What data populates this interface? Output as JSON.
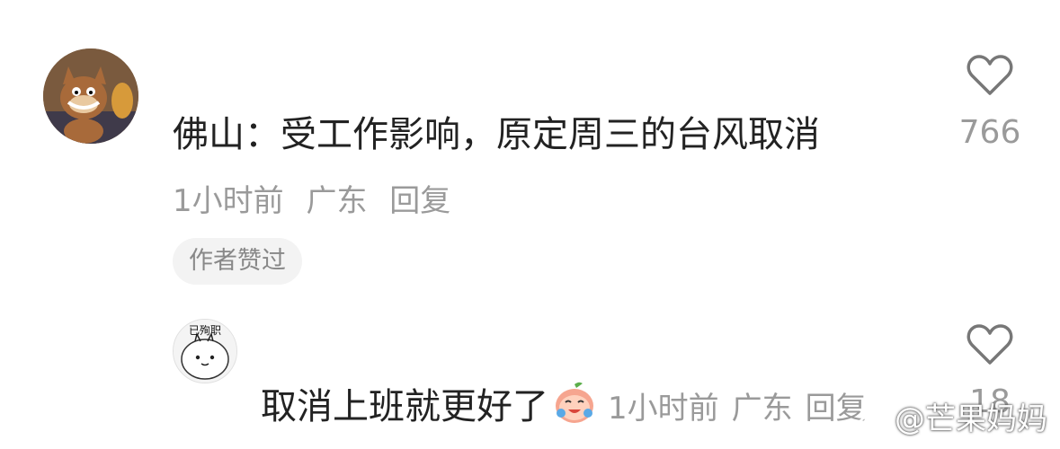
{
  "comments": [
    {
      "text": "佛山：受工作影响，原定周三的台风取消",
      "time": "1小时前",
      "location": "广东",
      "reply_label": "回复",
      "likes": "766",
      "author_liked_label": "作者赞过"
    },
    {
      "avatar_caption": "已殉职",
      "text": "取消上班就更好了",
      "emoji": "crying-laughing-peach-emoji",
      "time": "1小时前",
      "location": "广东",
      "reply_label": "回复",
      "likes": "18"
    }
  ],
  "watermark": "@芒果妈妈",
  "colors": {
    "text": "#222222",
    "meta": "#9a9a9a",
    "tag_bg": "#f3f3f3"
  }
}
